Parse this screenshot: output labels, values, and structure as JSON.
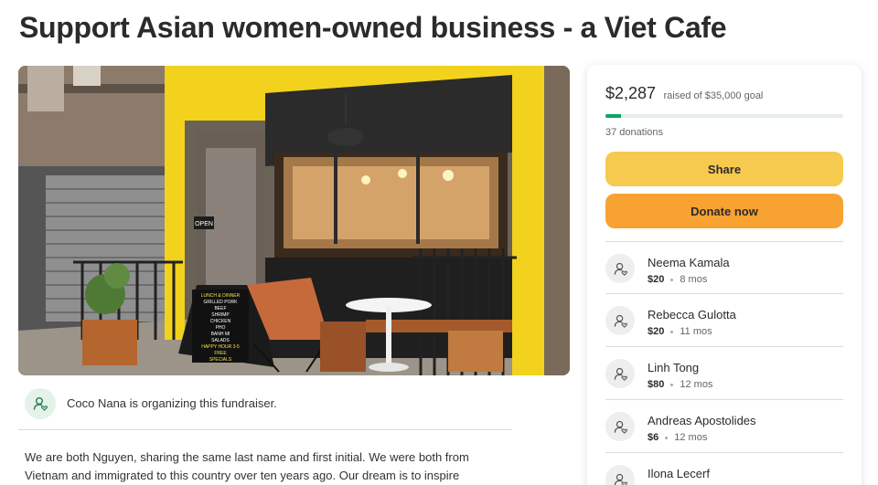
{
  "page": {
    "title": "Support Asian women-owned business - a Viet Cafe"
  },
  "hero": {
    "sign_lines": [
      "LUNCH & DINNER",
      "GRILLED PORK",
      "BEEF",
      "SHRIMP",
      "CHICKEN",
      "PHO",
      "BANH MI",
      "SALADS",
      "HAPPY HOUR 3-5",
      "FREE",
      "SPECIALS"
    ],
    "door_sign": "OPEN"
  },
  "organizer": {
    "text": "Coco Nana is organizing this fundraiser."
  },
  "story": {
    "line1": "We are both Nguyen, sharing the same last name and first initial. We were both from",
    "line2": "Vietnam and immigrated to this country over ten years ago. Our dream is to inspire"
  },
  "donation_card": {
    "raised": "$2,287",
    "goal_text": "raised of $35,000 goal",
    "progress_fraction": 0.065,
    "donation_count": "37 donations",
    "share_label": "Share",
    "donate_label": "Donate now"
  },
  "donors": [
    {
      "name": "Neema Kamala",
      "amount": "$20",
      "time": "8 mos"
    },
    {
      "name": "Rebecca Gulotta",
      "amount": "$20",
      "time": "11 mos"
    },
    {
      "name": "Linh Tong",
      "amount": "$80",
      "time": "12 mos"
    },
    {
      "name": "Andreas Apostolides",
      "amount": "$6",
      "time": "12 mos"
    },
    {
      "name": "Ilona Lecerf",
      "amount": "",
      "time": ""
    }
  ],
  "colors": {
    "brand_green": "#02a95c",
    "share_button": "#f6c94f",
    "donate_button": "#f8a232",
    "storefront_yellow": "#f2d21c"
  },
  "icons": {
    "organizer": "user-heart-icon",
    "donor": "user-heart-icon"
  }
}
